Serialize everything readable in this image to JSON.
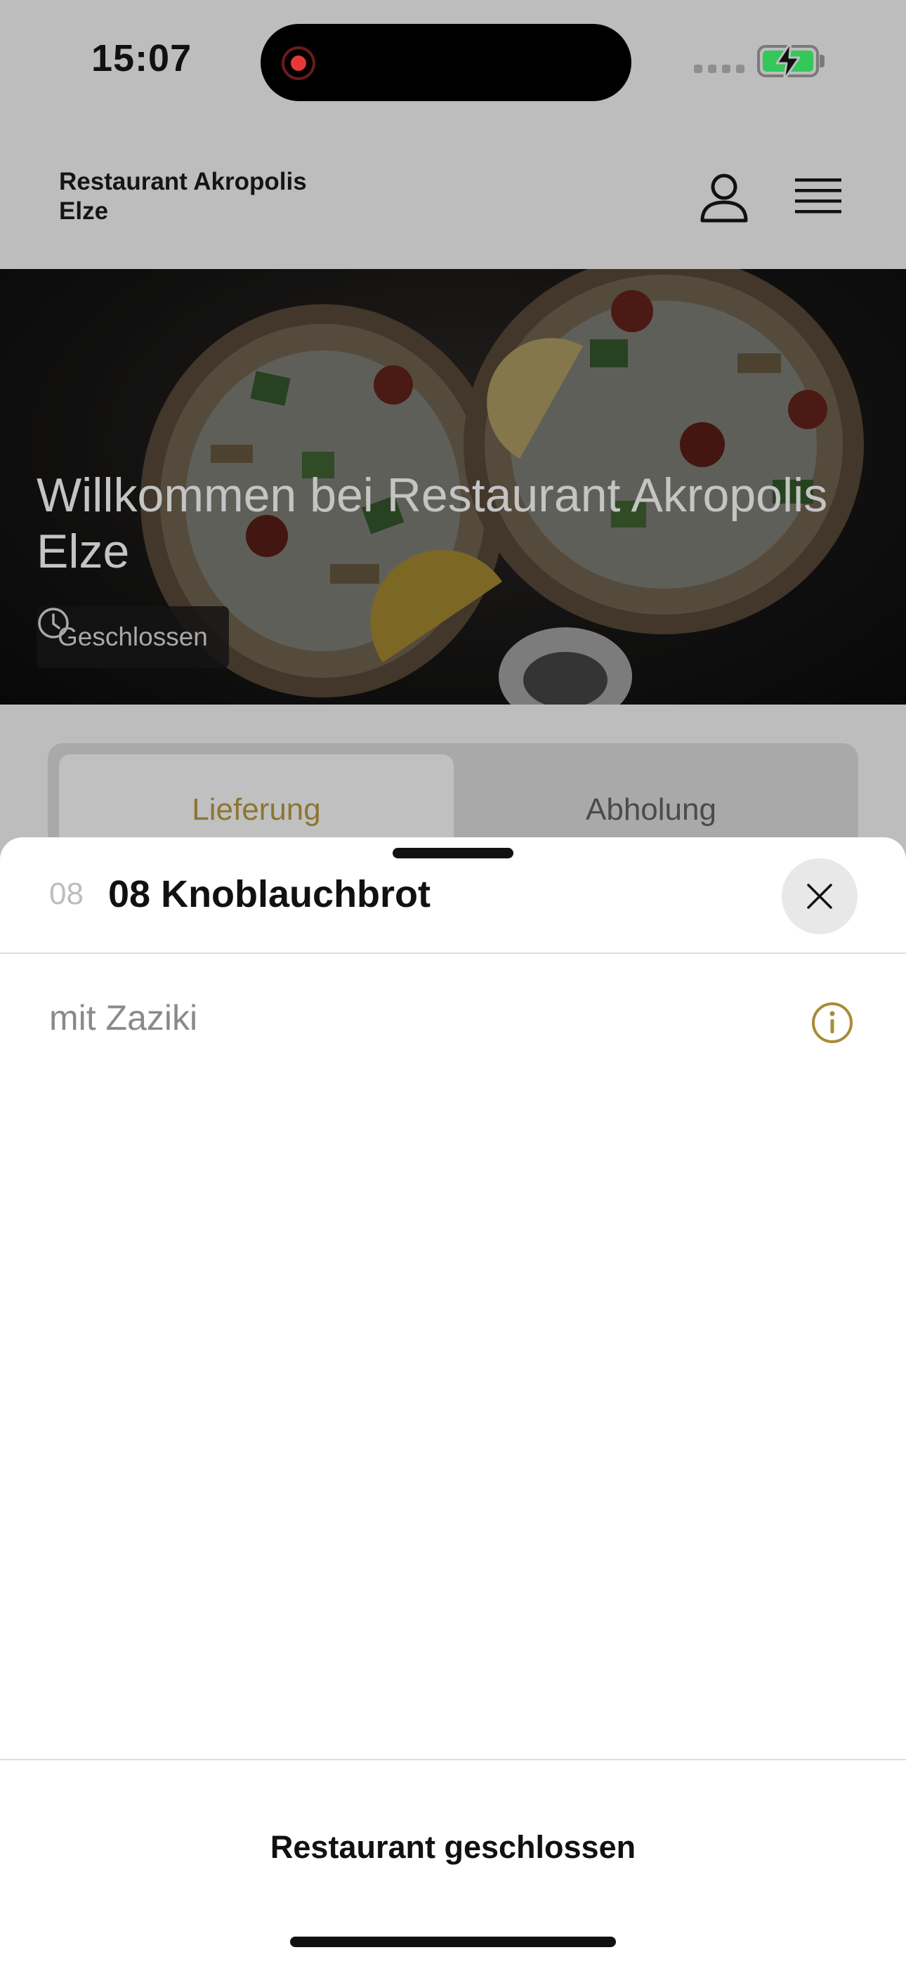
{
  "status_bar": {
    "time": "15:07",
    "recording_indicator": "screen-recording",
    "battery_state": "charging",
    "battery_color": "#34c759"
  },
  "header": {
    "brand_line1": "Restaurant Akropolis",
    "brand_line2": "Elze",
    "user_icon": "user-icon",
    "menu_icon": "hamburger-menu-icon"
  },
  "hero": {
    "title": "Willkommen bei Restaurant Akropolis Elze",
    "status_label": "Geschlossen",
    "status_icon": "clock-icon"
  },
  "tabs": [
    {
      "label": "Lieferung",
      "selected": true
    },
    {
      "label": "Abholung",
      "selected": false
    }
  ],
  "sheet": {
    "item_number": "08",
    "item_title": "08 Knoblauchbrot",
    "description": "mit Zaziki",
    "close_icon": "close-icon",
    "info_icon": "info-icon",
    "footer_label": "Restaurant geschlossen"
  },
  "colors": {
    "accent": "#a88c38",
    "overlay_background": "#bdbdbd",
    "sheet_background": "#ffffff"
  }
}
